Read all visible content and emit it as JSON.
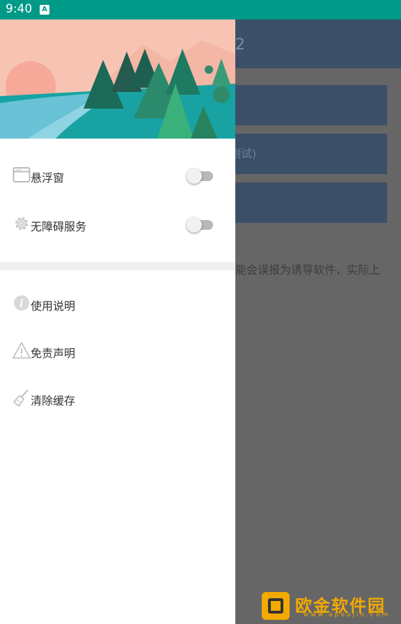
{
  "status_bar": {
    "time": "9:40",
    "notification_icon": "A"
  },
  "background_app": {
    "title_fragment": "2",
    "buttons": [
      "",
      "测试)",
      ""
    ],
    "text_fragment": "能会误报为诱导软件，实际上"
  },
  "drawer": {
    "toggles": [
      {
        "icon": "floating-window-icon",
        "label": "悬浮窗",
        "on": false
      },
      {
        "icon": "gear-icon",
        "label": "无障碍服务",
        "on": false
      }
    ],
    "menu": [
      {
        "icon": "info-icon",
        "label": "使用说明"
      },
      {
        "icon": "warning-icon",
        "label": "免责声明"
      },
      {
        "icon": "broom-icon",
        "label": "清除缓存"
      }
    ]
  },
  "watermark": {
    "name": "欧金软件园",
    "url": "www.apoujin.com"
  },
  "colors": {
    "status_bar": "#009a88",
    "toolbar": "#3c4f68",
    "watermark": "#f2a900"
  }
}
